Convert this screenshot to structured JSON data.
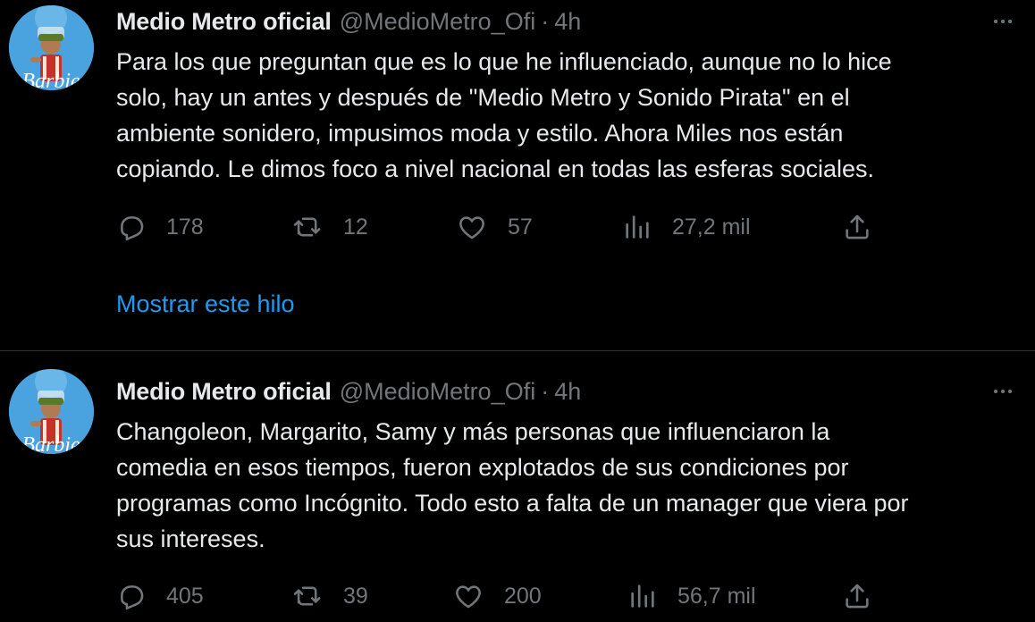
{
  "tweets": [
    {
      "display_name": "Medio Metro oficial",
      "handle": "@MedioMetro_Ofi",
      "separator": "·",
      "time": "4h",
      "lines": [
        "Para los que preguntan que es lo que he influenciado, aunque no lo hice",
        "solo, hay un antes y después de \"Medio Metro y Sonido Pirata\" en el",
        "ambiente sonidero, impusimos moda y estilo. Ahora Miles nos están",
        "copiando. Le dimos foco a nivel nacional en todas las esferas sociales."
      ],
      "replies": "178",
      "retweets": "12",
      "likes": "57",
      "views": "27,2 mil",
      "show_thread": "Mostrar este hilo"
    },
    {
      "display_name": "Medio Metro oficial",
      "handle": "@MedioMetro_Ofi",
      "separator": "·",
      "time": "4h",
      "lines": [
        "Changoleon, Margarito, Samy y más personas que influenciaron la",
        "comedia en esos tiempos, fueron explotados de sus condiciones  por",
        "programas como Incógnito. Todo esto a falta de un manager que viera por",
        "sus intereses."
      ],
      "replies": "405",
      "retweets": "39",
      "likes": "200",
      "views": "56,7 mil"
    }
  ],
  "avatar_text": "Barbie",
  "icons": {
    "reply": "reply-icon",
    "retweet": "retweet-icon",
    "like": "heart-icon",
    "views": "views-chart-icon",
    "share": "share-icon",
    "more": "more-icon"
  },
  "colors": {
    "background": "#000000",
    "text": "#e7e9ea",
    "secondary": "#71767b",
    "link": "#1d9bf0",
    "divider": "#2f3336"
  }
}
